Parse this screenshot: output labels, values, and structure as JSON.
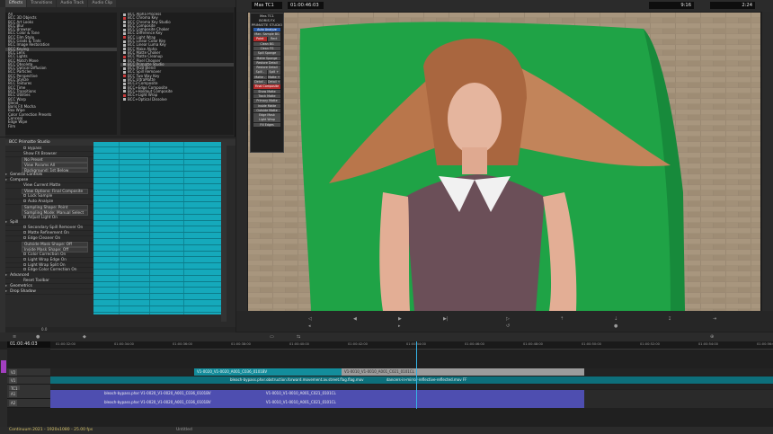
{
  "effect_palette": {
    "tabs": [
      "Effects",
      "Transitions",
      "Audio Track",
      "Audio Clip"
    ],
    "categories": [
      "All",
      "BCC 3D Objects",
      "BCC Art Looks",
      "BCC Blur",
      "BCC Browser",
      "BCC Color & Tone",
      "BCC Film Style",
      "BCC Grads & Tints",
      "BCC Image Restoration",
      "BCC Keying",
      "BCC Lens",
      "BCC Lights",
      "BCC Match Move",
      "BCC Obsolete",
      "BCC Optical Diffusion",
      "BCC Particles",
      "BCC Perspective",
      "BCC Stylize",
      "BCC Textures",
      "BCC Time",
      "BCC Transitions",
      "BCC Utilities",
      "BCC Warp",
      "Blend",
      "Boris FX Mocha",
      "Box Wipe",
      "Color Correction Presets",
      "Conceal",
      "Edge Wipe",
      "Film"
    ],
    "selected_category": "BCC Keying",
    "effects": [
      "BCC Alpha Process",
      "BCC Chroma Key",
      "BCC Chroma Key Studio",
      "BCC Composite",
      "BCC Composite Choker",
      "BCC Difference Key",
      "BCC Light Wrap",
      "BCC Linear Color Key",
      "BCC Linear Luma Key",
      "BCC Make Alpha",
      "BCC Matte Choker",
      "BCC Matte Cleanup",
      "BCC Pixel Chooser",
      "BCC Primatte Studio",
      "BCC RGB Blend",
      "BCC Spill Remover",
      "BCC Two Way Key",
      "BCC UltraMatte",
      "BCC3 Composite",
      "BCC+Edge Composite",
      "BCC+Holdout Composite",
      "BCC+Light Wrap",
      "BCC+Optical Dissolve"
    ],
    "selected_effect": "BCC Primatte Studio"
  },
  "effect_editor": {
    "title": "BCC Primatte Studio",
    "params": [
      {
        "label": "Bypass",
        "kind": "check",
        "indent": 2
      },
      {
        "label": "Show FX Browser",
        "kind": "text",
        "indent": 2
      },
      {
        "label": "No Preset",
        "kind": "drop",
        "indent": 1
      },
      {
        "label": "View Params All",
        "kind": "drop",
        "indent": 1
      },
      {
        "label": "Background: 1st Below",
        "kind": "drop",
        "indent": 1
      },
      {
        "label": "General Controls",
        "kind": "section",
        "indent": 0
      },
      {
        "label": "Compose",
        "kind": "section",
        "indent": 0
      },
      {
        "label": "View Current Matte",
        "kind": "text",
        "indent": 2
      },
      {
        "label": "View Options: Final Composite",
        "kind": "drop",
        "indent": 1
      },
      {
        "label": "Lock Sample",
        "kind": "check",
        "indent": 2
      },
      {
        "label": "Auto Analyze",
        "kind": "check",
        "indent": 2
      },
      {
        "label": "Sampling Shape: Point",
        "kind": "drop",
        "indent": 1
      },
      {
        "label": "Sampling Mode: Manual Select",
        "kind": "drop",
        "indent": 1
      },
      {
        "label": "Adjust Light On",
        "kind": "check",
        "indent": 2
      },
      {
        "label": "Spill",
        "kind": "section",
        "indent": 0
      },
      {
        "label": "Secondary Spill Remover On",
        "kind": "check",
        "indent": 2
      },
      {
        "label": "Matte Refinement On",
        "kind": "check",
        "indent": 2
      },
      {
        "label": "Edge Cleaner On",
        "kind": "check",
        "indent": 2
      },
      {
        "label": "Outside Mask Shape: Off",
        "kind": "drop",
        "indent": 1
      },
      {
        "label": "Inside Mask Shape: Off",
        "kind": "drop",
        "indent": 1
      },
      {
        "label": "Color Correction On",
        "kind": "check",
        "indent": 2
      },
      {
        "label": "Light Wrap Edge On",
        "kind": "check",
        "indent": 2
      },
      {
        "label": "Light Wrap Split On",
        "kind": "check",
        "indent": 2
      },
      {
        "label": "Edge Color Correction On",
        "kind": "check",
        "indent": 2
      },
      {
        "label": "Advanced",
        "kind": "section",
        "indent": 0
      },
      {
        "label": "Reset Toolbar",
        "kind": "text",
        "indent": 2
      },
      {
        "label": "Geometrics",
        "kind": "section",
        "indent": 0
      },
      {
        "label": "Drop Shadow",
        "kind": "section",
        "indent": 0
      }
    ],
    "position_label": "0.0"
  },
  "monitor": {
    "source_label": "Mas",
    "tc_label": "TC1",
    "timecode": "01:00:46:03",
    "right_readout_1": "9:16",
    "right_readout_2": "2:24"
  },
  "bcc_panel": {
    "header": [
      "Mas TC1",
      "BORIS FX",
      "PRIMATTE STUDIO"
    ],
    "items": [
      {
        "label": "Auto Analyze",
        "style": "blue"
      },
      {
        "label": "Man. Sample BG",
        "style": "normal"
      },
      {
        "pair": [
          "Point",
          "Rect"
        ],
        "style": "red-left"
      },
      {
        "label": "Clean BG",
        "style": "normal"
      },
      {
        "label": "Clean FG",
        "style": "normal"
      },
      {
        "label": "Spill Sponge",
        "style": "normal"
      },
      {
        "label": "Matte Sponge",
        "style": "normal"
      },
      {
        "label": "Restore Detail",
        "style": "normal"
      },
      {
        "label": "Restore Detail",
        "style": "normal"
      },
      {
        "pair": [
          "Spill -",
          "Spill +"
        ],
        "style": "normal"
      },
      {
        "pair": [
          "Matte -",
          "Matte +"
        ],
        "style": "normal"
      },
      {
        "pair": [
          "Detail -",
          "Detail +"
        ],
        "style": "normal"
      },
      {
        "label": "Final Composite",
        "style": "red"
      },
      {
        "label": "Show Matte",
        "style": "normal"
      },
      {
        "label": "Track Matte",
        "style": "normal"
      },
      {
        "label": "Primary Matte",
        "style": "normal"
      },
      {
        "label": "Inside Matte",
        "style": "normal"
      },
      {
        "label": "Outside Matte",
        "style": "normal"
      },
      {
        "label": "Edge Mask",
        "style": "normal"
      },
      {
        "label": "Light Wrap",
        "style": "normal"
      },
      {
        "label": "Fill Edges",
        "style": "normal"
      }
    ]
  },
  "timeline": {
    "timecode": "01:00:46:03",
    "ruler": [
      "01:00:32:00",
      "01:00:34:00",
      "01:00:36:00",
      "01:00:38:00",
      "01:00:40:00",
      "01:00:42:00",
      "01:00:44:00",
      "01:00:46:00",
      "01:00:48:00",
      "01:00:50:00",
      "01:00:52:00",
      "01:00:54:00",
      "01:00:56:00"
    ],
    "tracks": {
      "v2": {
        "label": "V2"
      },
      "v1": {
        "label": "V1"
      },
      "a1": {
        "label": "A1"
      },
      "a2": {
        "label": "A2"
      },
      "tc": {
        "label": "TC1"
      }
    },
    "clips": {
      "v2_a": "V1-0020_V1-0020_A001_C036_0101BV",
      "v2_b": "V1-0010_V1-0010_A001_C021_0101CL",
      "v1_a": "bleach-bypass.phxr.obstruction.forward.movement.av.street.flag.flag.mov",
      "v1_b": "dancers-in-mirror-reflective-reflected.mov FF",
      "a1_a": "bleach-bypass.phxr V1-0020_V1-0020_A001_C036_0101BV",
      "a1_b": "V1-0010_V1-0010_A001_C021_0101CL",
      "a2_a": "bleach-bypass.phxr V1-0020_V1-0020_A001_C036_0101BV",
      "a2_b": "V1-0010_V1-0010_A001_C021_0101CL"
    },
    "playhead_fraction": 0.506
  },
  "status": {
    "project": "Continuum 2021 - 1920x1080 - 25.00 fps",
    "mid": "Untitled"
  }
}
